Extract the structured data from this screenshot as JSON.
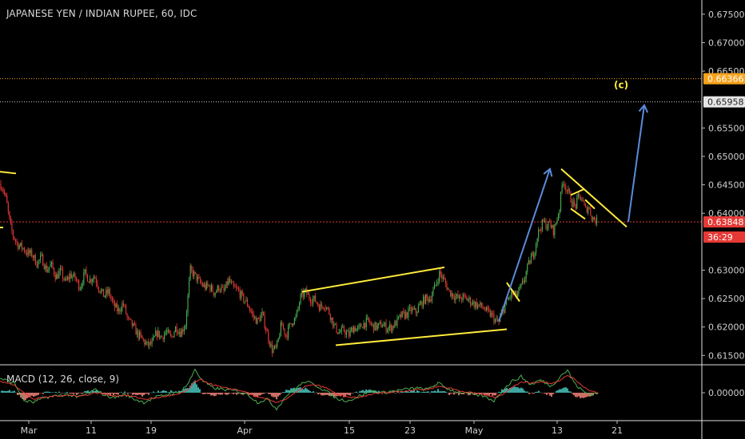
{
  "chart_title": "JAPANESE YEN / INDIAN RUPEE, 60, IDC",
  "macd_title": "MACD (12, 26, close, 9)",
  "colors": {
    "background": "#000000",
    "up": "#4caf50",
    "down": "#e53935",
    "trendline": "#ffeb3b",
    "arrow": "#5b8bd9",
    "current_price_line": "#e53935",
    "orange_line": "#f7a21b",
    "white_line": "#cfcfcf",
    "macd_line": "#4caf50",
    "signal_line": "#e53935",
    "hist_up": "#4dd0c8",
    "hist_down": "#ff8a80"
  },
  "chart_data": [
    {
      "type": "candlestick",
      "title": "JAPANESE YEN / INDIAN RUPEE, 60, IDC",
      "y_ticks": [
        "0.67500",
        "0.67000",
        "0.66500",
        "0.65500",
        "0.65000",
        "0.64500",
        "0.64000",
        "0.63000",
        "0.62500",
        "0.62000",
        "0.61500"
      ],
      "x_ticks": [
        "Mar",
        "11",
        "19",
        "Apr",
        "15",
        "23",
        "May",
        "13",
        "21"
      ],
      "ylim": [
        0.6135,
        0.6775
      ],
      "price_labels": [
        {
          "value": "0.66366",
          "color": "#f7a21b"
        },
        {
          "value": "0.65958",
          "color": "#cfcfcf"
        },
        {
          "value": "0.63848",
          "color": "#e53935"
        },
        {
          "value": "36:29",
          "color": "#e53935"
        }
      ],
      "annotations": [
        "(c)"
      ],
      "close_path": [
        [
          0,
          0.6452
        ],
        [
          4,
          0.6442
        ],
        [
          8,
          0.6422
        ],
        [
          12,
          0.6385
        ],
        [
          16,
          0.6362
        ],
        [
          22,
          0.6345
        ],
        [
          28,
          0.634
        ],
        [
          34,
          0.633
        ],
        [
          40,
          0.6328
        ],
        [
          46,
          0.6312
        ],
        [
          52,
          0.6322
        ],
        [
          58,
          0.63
        ],
        [
          64,
          0.631
        ],
        [
          70,
          0.6288
        ],
        [
          76,
          0.6298
        ],
        [
          82,
          0.6278
        ],
        [
          88,
          0.6292
        ],
        [
          94,
          0.6286
        ],
        [
          100,
          0.627
        ],
        [
          106,
          0.6295
        ],
        [
          112,
          0.6282
        ],
        [
          118,
          0.629
        ],
        [
          124,
          0.6268
        ],
        [
          130,
          0.6255
        ],
        [
          136,
          0.6262
        ],
        [
          142,
          0.6238
        ],
        [
          148,
          0.6228
        ],
        [
          154,
          0.6242
        ],
        [
          160,
          0.6212
        ],
        [
          166,
          0.6202
        ],
        [
          172,
          0.6188
        ],
        [
          178,
          0.6178
        ],
        [
          184,
          0.6168
        ],
        [
          190,
          0.617
        ],
        [
          196,
          0.619
        ],
        [
          202,
          0.6182
        ],
        [
          208,
          0.6192
        ],
        [
          214,
          0.618
        ],
        [
          220,
          0.62
        ],
        [
          226,
          0.619
        ],
        [
          232,
          0.6205
        ],
        [
          238,
          0.63
        ],
        [
          244,
          0.629
        ],
        [
          250,
          0.6278
        ],
        [
          256,
          0.627
        ],
        [
          262,
          0.6272
        ],
        [
          268,
          0.626
        ],
        [
          274,
          0.627
        ],
        [
          280,
          0.6262
        ],
        [
          286,
          0.6282
        ],
        [
          292,
          0.6268
        ],
        [
          298,
          0.6264
        ],
        [
          304,
          0.625
        ],
        [
          310,
          0.624
        ],
        [
          316,
          0.622
        ],
        [
          322,
          0.621
        ],
        [
          328,
          0.6222
        ],
        [
          334,
          0.619
        ],
        [
          340,
          0.616
        ],
        [
          346,
          0.6162
        ],
        [
          352,
          0.6205
        ],
        [
          358,
          0.6185
        ],
        [
          364,
          0.6208
        ],
        [
          370,
          0.6215
        ],
        [
          376,
          0.6252
        ],
        [
          382,
          0.6262
        ],
        [
          388,
          0.625
        ],
        [
          394,
          0.6248
        ],
        [
          400,
          0.6235
        ],
        [
          406,
          0.624
        ],
        [
          412,
          0.6225
        ],
        [
          418,
          0.6202
        ],
        [
          424,
          0.619
        ],
        [
          430,
          0.6195
        ],
        [
          436,
          0.6185
        ],
        [
          442,
          0.62
        ],
        [
          448,
          0.6195
        ],
        [
          454,
          0.6205
        ],
        [
          460,
          0.621
        ],
        [
          466,
          0.6202
        ],
        [
          472,
          0.62
        ],
        [
          478,
          0.6205
        ],
        [
          484,
          0.6198
        ],
        [
          490,
          0.62
        ],
        [
          496,
          0.6208
        ],
        [
          502,
          0.622
        ],
        [
          508,
          0.6222
        ],
        [
          514,
          0.623
        ],
        [
          520,
          0.6226
        ],
        [
          526,
          0.624
        ],
        [
          532,
          0.625
        ],
        [
          538,
          0.625
        ],
        [
          544,
          0.627
        ],
        [
          550,
          0.6295
        ],
        [
          556,
          0.628
        ],
        [
          562,
          0.6262
        ],
        [
          568,
          0.6255
        ],
        [
          574,
          0.625
        ],
        [
          580,
          0.6252
        ],
        [
          586,
          0.6248
        ],
        [
          592,
          0.6242
        ],
        [
          598,
          0.6238
        ],
        [
          604,
          0.6235
        ],
        [
          610,
          0.6225
        ],
        [
          616,
          0.622
        ],
        [
          620,
          0.621
        ],
        [
          624,
          0.6208
        ],
        [
          628,
          0.6225
        ],
        [
          634,
          0.6245
        ],
        [
          640,
          0.6258
        ],
        [
          646,
          0.6255
        ],
        [
          652,
          0.627
        ],
        [
          656,
          0.6285
        ],
        [
          660,
          0.6305
        ],
        [
          664,
          0.632
        ],
        [
          668,
          0.633
        ],
        [
          672,
          0.636
        ],
        [
          676,
          0.6375
        ],
        [
          680,
          0.6385
        ],
        [
          684,
          0.6378
        ],
        [
          688,
          0.6382
        ],
        [
          692,
          0.6368
        ],
        [
          696,
          0.6385
        ],
        [
          700,
          0.641
        ],
        [
          704,
          0.646
        ],
        [
          708,
          0.6445
        ],
        [
          712,
          0.6432
        ],
        [
          716,
          0.6418
        ],
        [
          720,
          0.6412
        ],
        [
          724,
          0.643
        ],
        [
          728,
          0.6425
        ],
        [
          732,
          0.6405
        ],
        [
          736,
          0.6412
        ],
        [
          740,
          0.6395
        ],
        [
          744,
          0.6388
        ],
        [
          748,
          0.6385
        ]
      ],
      "trendlines": [
        [
          [
            0,
            0.6473
          ],
          [
            20,
            0.647
          ]
        ],
        [
          [
            0,
            0.6375
          ],
          [
            4,
            0.6375
          ]
        ],
        [
          [
            378,
            0.6262
          ],
          [
            556,
            0.6305
          ]
        ],
        [
          [
            420,
            0.6168
          ],
          [
            634,
            0.6196
          ]
        ],
        [
          [
            634,
            0.6278
          ],
          [
            650,
            0.6245
          ]
        ],
        [
          [
            702,
            0.6478
          ],
          [
            784,
            0.6376
          ]
        ],
        [
          [
            714,
            0.6432
          ],
          [
            730,
            0.6442
          ]
        ],
        [
          [
            714,
            0.6408
          ],
          [
            732,
            0.639
          ]
        ],
        [
          [
            732,
            0.6424
          ],
          [
            744,
            0.6408
          ]
        ]
      ],
      "arrows": [
        [
          [
            624,
            0.621
          ],
          [
            688,
            0.6478
          ]
        ],
        [
          [
            786,
            0.6385
          ],
          [
            806,
            0.659
          ]
        ]
      ]
    },
    {
      "type": "macd",
      "title": "MACD (12, 26, close, 9)",
      "y_ticks": [
        "0.00000"
      ],
      "macd_line": [
        [
          0,
          0.0018
        ],
        [
          18,
          0.0012
        ],
        [
          30,
          -0.001
        ],
        [
          42,
          -0.0012
        ],
        [
          56,
          -0.0006
        ],
        [
          70,
          -0.0004
        ],
        [
          84,
          -0.0002
        ],
        [
          96,
          -0.0006
        ],
        [
          108,
          -0.0002
        ],
        [
          120,
          0.0004
        ],
        [
          132,
          -0.0004
        ],
        [
          144,
          -0.0006
        ],
        [
          156,
          -0.0002
        ],
        [
          168,
          -0.0008
        ],
        [
          180,
          -0.0012
        ],
        [
          194,
          -0.0006
        ],
        [
          210,
          -0.0002
        ],
        [
          224,
          0.0
        ],
        [
          236,
          0.0012
        ],
        [
          244,
          0.003
        ],
        [
          252,
          0.0016
        ],
        [
          266,
          0.0006
        ],
        [
          280,
          0.0004
        ],
        [
          296,
          0.0002
        ],
        [
          310,
          -0.0002
        ],
        [
          322,
          -0.0012
        ],
        [
          334,
          -0.0008
        ],
        [
          346,
          -0.002
        ],
        [
          358,
          -0.0004
        ],
        [
          370,
          0.0006
        ],
        [
          382,
          0.0014
        ],
        [
          394,
          0.001
        ],
        [
          408,
          0.0002
        ],
        [
          422,
          -0.0008
        ],
        [
          436,
          -0.001
        ],
        [
          450,
          -0.0004
        ],
        [
          464,
          0.0002
        ],
        [
          478,
          0.0
        ],
        [
          492,
          0.0002
        ],
        [
          506,
          0.0004
        ],
        [
          520,
          0.0006
        ],
        [
          534,
          0.0004
        ],
        [
          548,
          0.0012
        ],
        [
          562,
          0.0004
        ],
        [
          576,
          0.0
        ],
        [
          590,
          -0.0002
        ],
        [
          604,
          -0.0004
        ],
        [
          618,
          -0.001
        ],
        [
          628,
          0.0002
        ],
        [
          640,
          0.0014
        ],
        [
          652,
          0.002
        ],
        [
          664,
          0.001
        ],
        [
          676,
          0.0016
        ],
        [
          690,
          0.0008
        ],
        [
          702,
          0.0022
        ],
        [
          710,
          0.0028
        ],
        [
          720,
          0.001
        ],
        [
          732,
          0.0
        ],
        [
          740,
          -0.0002
        ],
        [
          748,
          0.0
        ]
      ],
      "signal_line": [
        [
          0,
          0.0014
        ],
        [
          18,
          0.001
        ],
        [
          30,
          0.0
        ],
        [
          42,
          -0.0008
        ],
        [
          56,
          -0.0006
        ],
        [
          70,
          -0.0004
        ],
        [
          84,
          -0.0003
        ],
        [
          96,
          -0.0004
        ],
        [
          108,
          -0.0003
        ],
        [
          120,
          0.0
        ],
        [
          132,
          -0.0002
        ],
        [
          144,
          -0.0004
        ],
        [
          156,
          -0.0003
        ],
        [
          168,
          -0.0005
        ],
        [
          180,
          -0.0008
        ],
        [
          194,
          -0.0007
        ],
        [
          210,
          -0.0004
        ],
        [
          224,
          -0.0002
        ],
        [
          236,
          0.0004
        ],
        [
          244,
          0.0014
        ],
        [
          252,
          0.0016
        ],
        [
          266,
          0.001
        ],
        [
          280,
          0.0006
        ],
        [
          296,
          0.0004
        ],
        [
          310,
          0.0
        ],
        [
          322,
          -0.0006
        ],
        [
          334,
          -0.0008
        ],
        [
          346,
          -0.0012
        ],
        [
          358,
          -0.0008
        ],
        [
          370,
          0.0
        ],
        [
          382,
          0.0008
        ],
        [
          394,
          0.001
        ],
        [
          408,
          0.0006
        ],
        [
          422,
          -0.0002
        ],
        [
          436,
          -0.0006
        ],
        [
          450,
          -0.0006
        ],
        [
          464,
          -0.0002
        ],
        [
          478,
          0.0
        ],
        [
          492,
          0.0001
        ],
        [
          506,
          0.0002
        ],
        [
          520,
          0.0004
        ],
        [
          534,
          0.0004
        ],
        [
          548,
          0.0008
        ],
        [
          562,
          0.0006
        ],
        [
          576,
          0.0002
        ],
        [
          590,
          0.0
        ],
        [
          604,
          -0.0002
        ],
        [
          618,
          -0.0006
        ],
        [
          628,
          -0.0002
        ],
        [
          640,
          0.0006
        ],
        [
          652,
          0.0014
        ],
        [
          664,
          0.0012
        ],
        [
          676,
          0.0014
        ],
        [
          690,
          0.0012
        ],
        [
          702,
          0.0016
        ],
        [
          710,
          0.0022
        ],
        [
          720,
          0.0016
        ],
        [
          732,
          0.0006
        ],
        [
          740,
          0.0002
        ],
        [
          748,
          0.0
        ]
      ],
      "ylim": [
        -0.0034,
        0.0034
      ]
    }
  ]
}
